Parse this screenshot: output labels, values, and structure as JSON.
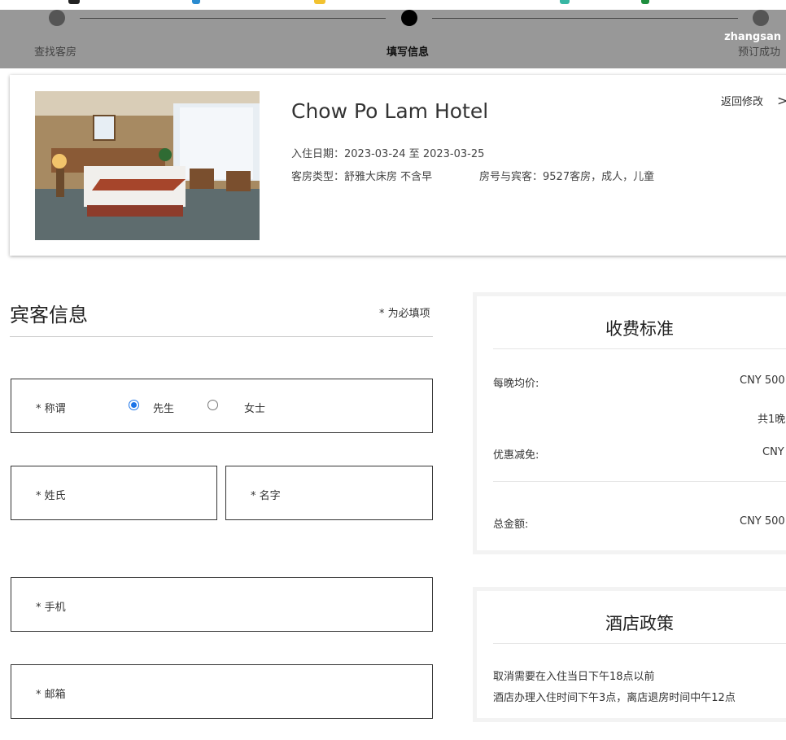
{
  "progress": {
    "steps": [
      {
        "label": "查找客房",
        "active": false
      },
      {
        "label": "填写信息",
        "active": true
      },
      {
        "label": "预订成功",
        "active": false
      }
    ],
    "username": "zhangsan"
  },
  "hotel": {
    "name": "Chow Po Lam Hotel",
    "checkin_line": "入住日期：2023-03-24  至  2023-03-25",
    "room_type_line": "客房类型：舒雅大床房 不含早",
    "room_guest_line": "房号与宾客：9527客房，成人，儿童",
    "back_label": "返回修改",
    "back_arrow": ">"
  },
  "guest_form": {
    "title": "宾客信息",
    "required_note": "* 为必填项",
    "salutation_label": "* 称谓",
    "salutation_options": [
      "先生",
      "女士"
    ],
    "salutation_selected": "先生",
    "surname_label": "* 姓氏",
    "given_name_label": "* 名字",
    "phone_label": "* 手机",
    "email_label": "* 邮箱"
  },
  "fees": {
    "title": "收费标准",
    "nightly_label": "每晚均价:",
    "nightly_value": "CNY 500",
    "nights_value": "共1晚",
    "discount_label": "优惠减免:",
    "discount_value": "CNY",
    "total_label": "总金额:",
    "total_value": "CNY 500"
  },
  "policy": {
    "title": "酒店政策",
    "lines": [
      "取消需要在入住当日下午18点以前",
      "酒店办理入住时间下午3点，离店退房时间中午12点"
    ]
  },
  "colors": {
    "progress_bg": "#989898",
    "radio_accent": "#1a73e8"
  }
}
